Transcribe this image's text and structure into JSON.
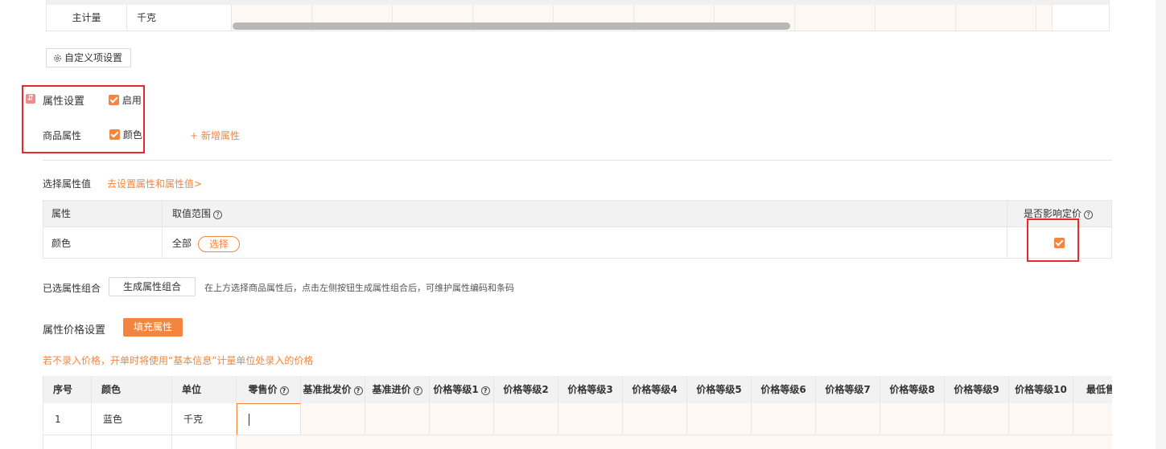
{
  "unit_table": {
    "label": "主计量",
    "unit": "千克"
  },
  "custom_button": "自定义项设置",
  "attr_settings": {
    "title": "属性设置",
    "enable_label": "启用",
    "goods_attr_label": "商品属性",
    "color_attr": "颜色",
    "add_attr": "+ 新增属性"
  },
  "select_values": {
    "label": "选择属性值",
    "link": "去设置属性和属性值>"
  },
  "attr_table": {
    "headers": [
      "属性",
      "取值范围",
      "是否影响定价"
    ],
    "row": {
      "attr": "颜色",
      "range": "全部",
      "select": "选择"
    }
  },
  "combo": {
    "label": "已选属性组合",
    "button": "生成属性组合",
    "hint": "在上方选择商品属性后，点击左侧按钮生成属性组合后，可维护属性编码和条码"
  },
  "price_settings": {
    "title": "属性价格设置",
    "fill_button": "填充属性",
    "warning": "若不录入价格，开单时将使用“基本信息”计量单位处录入的价格"
  },
  "price_table": {
    "headers": [
      "序号",
      "颜色",
      "单位",
      "零售价",
      "基准批发价",
      "基准进价",
      "价格等级1",
      "价格等级2",
      "价格等级3",
      "价格等级4",
      "价格等级5",
      "价格等级6",
      "价格等级7",
      "价格等级8",
      "价格等级9",
      "价格等级10",
      "最低售"
    ],
    "rows": [
      {
        "index": "1",
        "color": "蓝色",
        "unit": "千克"
      }
    ]
  },
  "colors": {
    "accent": "#f4853f",
    "highlight": "#e8292b",
    "header_bg": "#f2f2f2"
  }
}
